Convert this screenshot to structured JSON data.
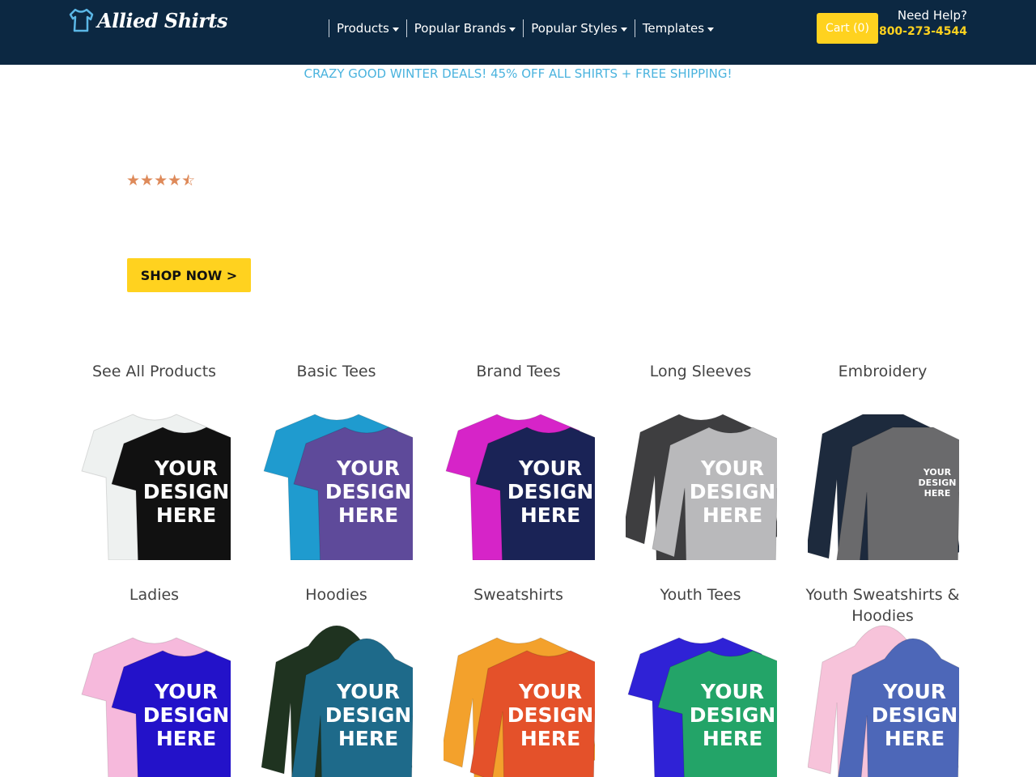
{
  "header": {
    "logo_text": "Allied Shirts",
    "nav": [
      {
        "label": "Products"
      },
      {
        "label": "Popular Brands"
      },
      {
        "label": "Popular Styles"
      },
      {
        "label": "Templates"
      }
    ],
    "cart_label": "Cart (0)",
    "help_label": "Need Help?",
    "help_phone": "800-273-4544"
  },
  "promo": "CRAZY GOOD WINTER DEALS! 45% OFF ALL SHIRTS + FREE SHIPPING!",
  "hero": {
    "rating_stars": 4.5,
    "rating_max": 5,
    "shop_button": "SHOP NOW >"
  },
  "products": [
    {
      "title": "See All Products",
      "back_color": "#eef1f0",
      "front_color": "#111111",
      "print": "YOUR DESIGN HERE",
      "kind": "tee"
    },
    {
      "title": "Basic Tees",
      "back_color": "#1f9bcf",
      "front_color": "#5e4a9a",
      "print": "YOUR DESIGN HERE",
      "kind": "tee"
    },
    {
      "title": "Brand Tees",
      "back_color": "#d624c8",
      "front_color": "#1a2356",
      "print": "YOUR DESIGN HERE",
      "kind": "tee"
    },
    {
      "title": "Long Sleeves",
      "back_color": "#3e3e40",
      "front_color": "#b9b9bb",
      "print": "YOUR DESIGN HERE",
      "kind": "longsleeve"
    },
    {
      "title": "Embroidery",
      "back_color": "#1d2a3d",
      "front_color": "#6a6a6c",
      "print": "YOUR DESIGN HERE",
      "kind": "quarterzip"
    },
    {
      "title": "Ladies",
      "back_color": "#f6b9dc",
      "front_color": "#2312c9",
      "print": "YOUR DESIGN HERE",
      "kind": "tee"
    },
    {
      "title": "Hoodies",
      "back_color": "#1f3320",
      "front_color": "#1e6a8a",
      "print": "YOUR DESIGN HERE",
      "kind": "hoodie"
    },
    {
      "title": "Sweatshirts",
      "back_color": "#f3a12c",
      "front_color": "#e4512a",
      "print": "YOUR DESIGN HERE",
      "kind": "longsleeve"
    },
    {
      "title": "Youth Tees",
      "back_color": "#2f22d6",
      "front_color": "#23a468",
      "print": "YOUR DESIGN HERE",
      "kind": "tee"
    },
    {
      "title": "Youth Sweatshirts & Hoodies",
      "back_color": "#f7c3da",
      "front_color": "#4d67b8",
      "print": "YOUR DESIGN HERE",
      "kind": "hoodie"
    }
  ],
  "colors": {
    "header_bg": "#0c2842",
    "accent_yellow": "#ffd21f",
    "promo_blue": "#4ab3de",
    "star_color": "#de8a5a"
  }
}
